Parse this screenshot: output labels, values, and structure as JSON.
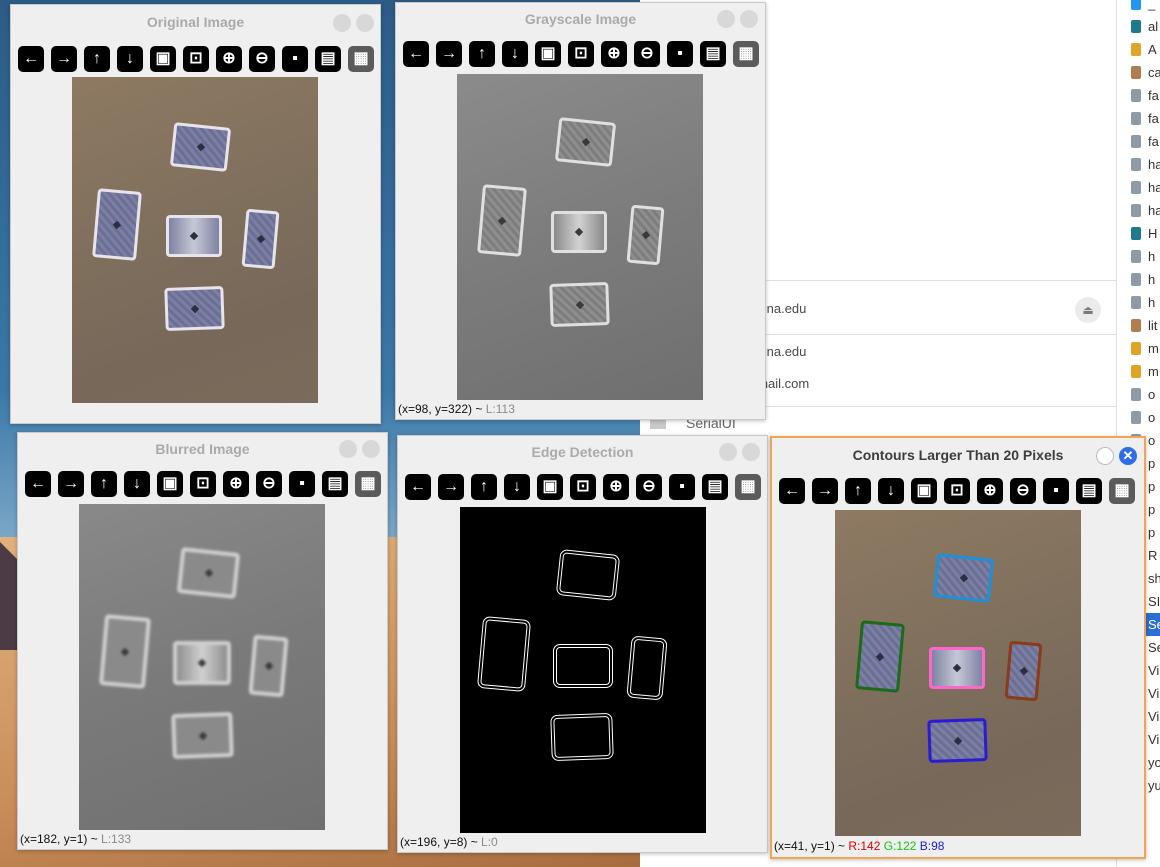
{
  "file_manager": {
    "rows": [
      {
        "text": "izona.edu"
      },
      {
        "text": "izona.edu"
      },
      {
        "text": "gmail.com"
      }
    ],
    "serial_label": "SerialUI",
    "items": [
      {
        "label": "_",
        "color": "#2196f3"
      },
      {
        "label": "al",
        "color": "#1f7a8c"
      },
      {
        "label": "A",
        "color": "#e0a528"
      },
      {
        "label": "ca",
        "color": "#b07d4f"
      },
      {
        "label": "fa",
        "color": "#8e9aa6"
      },
      {
        "label": "fa",
        "color": "#8e9aa6"
      },
      {
        "label": "fa",
        "color": "#8e9aa6"
      },
      {
        "label": "ha",
        "color": "#8e9aa6"
      },
      {
        "label": "ha",
        "color": "#8e9aa6"
      },
      {
        "label": "ha",
        "color": "#8e9aa6"
      },
      {
        "label": "H",
        "color": "#1f7a8c"
      },
      {
        "label": "h",
        "color": "#8e9aa6"
      },
      {
        "label": "h",
        "color": "#8e9aa6"
      },
      {
        "label": "h",
        "color": "#8e9aa6"
      },
      {
        "label": "lit",
        "color": "#b07d4f"
      },
      {
        "label": "m",
        "color": "#e0a528"
      },
      {
        "label": "m",
        "color": "#e0a528"
      },
      {
        "label": "o",
        "color": "#8e9aa6"
      },
      {
        "label": "o",
        "color": "#8e9aa6"
      },
      {
        "label": "o",
        "color": "#8e9aa6"
      },
      {
        "label": "p",
        "color": ""
      },
      {
        "label": "p",
        "color": ""
      },
      {
        "label": "p",
        "color": ""
      },
      {
        "label": "p",
        "color": ""
      },
      {
        "label": "R",
        "color": ""
      },
      {
        "label": "sh",
        "color": ""
      },
      {
        "label": "SI",
        "color": ""
      },
      {
        "label": "Se",
        "color": "",
        "selected": true
      },
      {
        "label": "Se",
        "color": ""
      },
      {
        "label": "Vi",
        "color": ""
      },
      {
        "label": "Vi",
        "color": ""
      },
      {
        "label": "Vi",
        "color": ""
      },
      {
        "label": "Vi",
        "color": ""
      },
      {
        "label": "yo",
        "color": ""
      },
      {
        "label": "yu",
        "color": ""
      }
    ]
  },
  "toolbar_icons": [
    "arrow-left-icon",
    "arrow-right-icon",
    "arrow-up-icon",
    "arrow-down-icon",
    "image-icon",
    "image-search-icon",
    "zoom-in-icon",
    "zoom-out-icon",
    "save-icon",
    "clipboard-icon",
    "paint-brush-icon"
  ],
  "windows": {
    "original": {
      "title": "Original Image",
      "status": ""
    },
    "grayscale": {
      "title": "Grayscale Image",
      "status_coords": "(x=98, y=322) ~ ",
      "status_l": "L:113"
    },
    "blurred": {
      "title": "Blurred Image",
      "status_coords": "(x=182, y=1) ~ ",
      "status_l": "L:133"
    },
    "edge": {
      "title": "Edge Detection",
      "status_coords": "(x=196, y=8) ~ ",
      "status_l": "L:0"
    },
    "contours": {
      "title": "Contours Larger Than 20 Pixels",
      "status_coords": "(x=41, y=1) ~ ",
      "status_r": "R:142",
      "status_g": "G:122",
      "status_b": "B:98",
      "contour_colors": [
        "#1e90d8",
        "#1a6b1a",
        "#ff66cc",
        "#8b3a1a",
        "#2b1ad6"
      ]
    }
  }
}
